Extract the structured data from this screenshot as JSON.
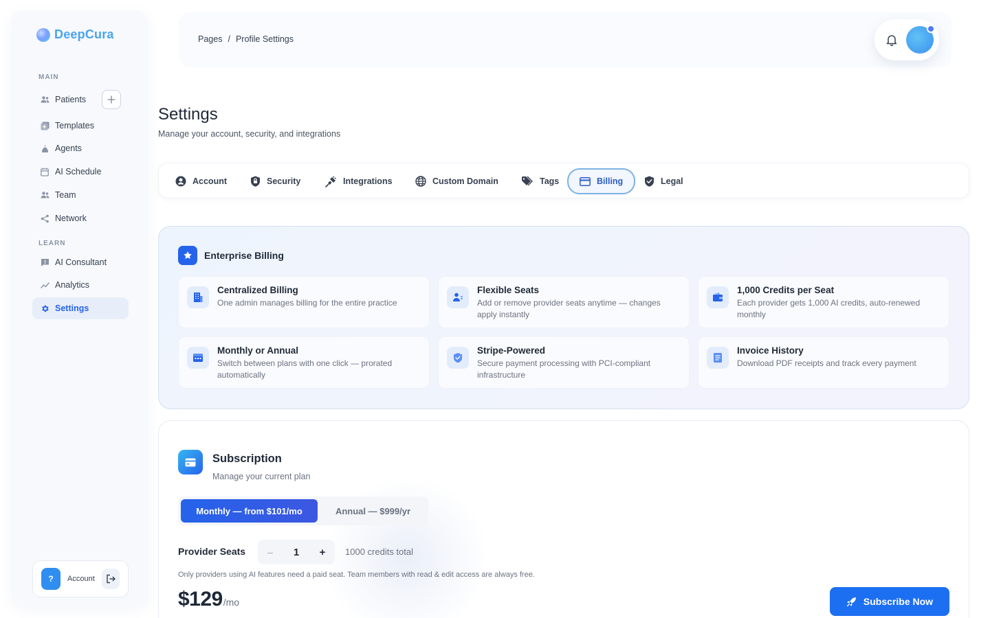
{
  "app": {
    "name": "DeepCura"
  },
  "sidebar": {
    "sections": {
      "main": "MAIN",
      "learn": "LEARN"
    },
    "items": [
      {
        "label": "Patients",
        "icon": "users-icon"
      },
      {
        "label": "Templates",
        "icon": "templates-icon"
      },
      {
        "label": "Agents",
        "icon": "agent-icon"
      },
      {
        "label": "AI Schedule",
        "icon": "calendar-icon"
      },
      {
        "label": "Team",
        "icon": "team-icon"
      },
      {
        "label": "Network",
        "icon": "share-icon"
      },
      {
        "label": "AI Consultant",
        "icon": "chat-alert-icon"
      },
      {
        "label": "Analytics",
        "icon": "chart-line-icon"
      },
      {
        "label": "Settings",
        "icon": "gear-icon"
      }
    ],
    "active": "Settings",
    "account": {
      "help_label": "?",
      "label": "Account"
    }
  },
  "header": {
    "breadcrumb": {
      "root": "Pages",
      "separator": "/",
      "current": "Profile Settings"
    }
  },
  "page": {
    "title": "Settings",
    "subtitle": "Manage your account, security, and integrations"
  },
  "tabs": [
    {
      "label": "Account",
      "icon": "account-circle-icon"
    },
    {
      "label": "Security",
      "icon": "shield-lock-icon"
    },
    {
      "label": "Integrations",
      "icon": "plug-icon"
    },
    {
      "label": "Custom Domain",
      "icon": "globe-icon"
    },
    {
      "label": "Tags",
      "icon": "tags-icon"
    },
    {
      "label": "Billing",
      "icon": "credit-card-icon"
    },
    {
      "label": "Legal",
      "icon": "shield-check-icon"
    }
  ],
  "active_tab": "Billing",
  "enterprise": {
    "title": "Enterprise Billing",
    "features": [
      {
        "title": "Centralized Billing",
        "desc": "One admin manages billing for the entire practice",
        "icon": "building-icon"
      },
      {
        "title": "Flexible Seats",
        "desc": "Add or remove provider seats anytime — changes apply instantly",
        "icon": "user-switch-icon"
      },
      {
        "title": "1,000 Credits per Seat",
        "desc": "Each provider gets 1,000 AI credits, auto-renewed monthly",
        "icon": "wallet-icon"
      },
      {
        "title": "Monthly or Annual",
        "desc": "Switch between plans with one click — prorated automatically",
        "icon": "calendar-month-icon"
      },
      {
        "title": "Stripe-Powered",
        "desc": "Secure payment processing with PCI-compliant infrastructure",
        "icon": "shield-check-icon"
      },
      {
        "title": "Invoice History",
        "desc": "Download PDF receipts and track every payment",
        "icon": "document-icon"
      }
    ]
  },
  "subscription": {
    "title": "Subscription",
    "subtitle": "Manage your current plan",
    "plan_options": {
      "monthly": "Monthly — from $101/mo",
      "annual": "Annual — $999/yr"
    },
    "selected_plan": "monthly",
    "seats_label": "Provider Seats",
    "seats_minus": "–",
    "seats_value": "1",
    "seats_plus": "+",
    "credits_total": "1000 credits total",
    "note": "Only providers using AI features need a paid seat. Team members with read & edit access are always free.",
    "price": "$129",
    "price_period": "/mo",
    "subscribe_label": "Subscribe Now"
  },
  "colors": {
    "accent": "#2563eb",
    "brand": "#4aa3f0",
    "active_tab_border": "#7fb0e6"
  }
}
